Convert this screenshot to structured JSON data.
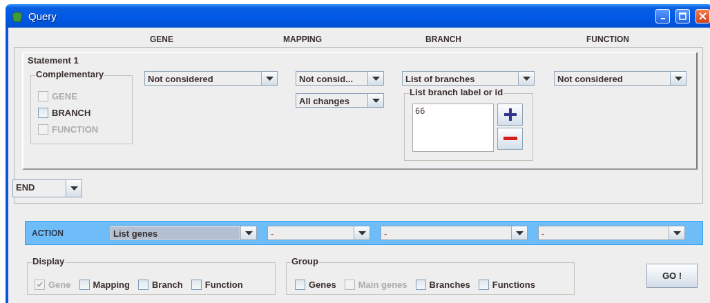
{
  "window": {
    "title": "Query"
  },
  "column_headers": [
    "GENE",
    "MAPPING",
    "BRANCH",
    "FUNCTION"
  ],
  "statement": {
    "title": "Statement 1",
    "complementary": {
      "title": "Complementary",
      "options": [
        {
          "label": "GENE",
          "checked": false,
          "disabled": true
        },
        {
          "label": "BRANCH",
          "checked": false,
          "disabled": false
        },
        {
          "label": "FUNCTION",
          "checked": false,
          "disabled": true
        }
      ]
    },
    "gene_filter": {
      "value": "Not considered"
    },
    "mapping_filter": {
      "value": "Not consid..."
    },
    "mapping_changes": {
      "value": "All changes"
    },
    "branch_filter": {
      "value": "List of branches"
    },
    "branch_list": {
      "title": "List branch label or id",
      "items": [
        "66"
      ]
    },
    "function_filter": {
      "value": "Not considered"
    }
  },
  "connector": {
    "value": "END"
  },
  "action": {
    "label": "ACTION",
    "selects": [
      {
        "value": "List genes",
        "focused": true
      },
      {
        "value": "-",
        "focused": false
      },
      {
        "value": "-",
        "focused": false
      },
      {
        "value": "-",
        "focused": false
      }
    ]
  },
  "display": {
    "title": "Display",
    "options": [
      {
        "label": "Gene",
        "checked": true,
        "disabled": true
      },
      {
        "label": "Mapping",
        "checked": false,
        "disabled": false
      },
      {
        "label": "Branch",
        "checked": false,
        "disabled": false
      },
      {
        "label": "Function",
        "checked": false,
        "disabled": false
      }
    ]
  },
  "group": {
    "title": "Group",
    "options": [
      {
        "label": "Genes",
        "checked": false,
        "disabled": false
      },
      {
        "label": "Main genes",
        "checked": false,
        "disabled": true
      },
      {
        "label": "Branches",
        "checked": false,
        "disabled": false
      },
      {
        "label": "Functions",
        "checked": false,
        "disabled": false
      }
    ]
  },
  "go_button": {
    "label": "GO !"
  }
}
